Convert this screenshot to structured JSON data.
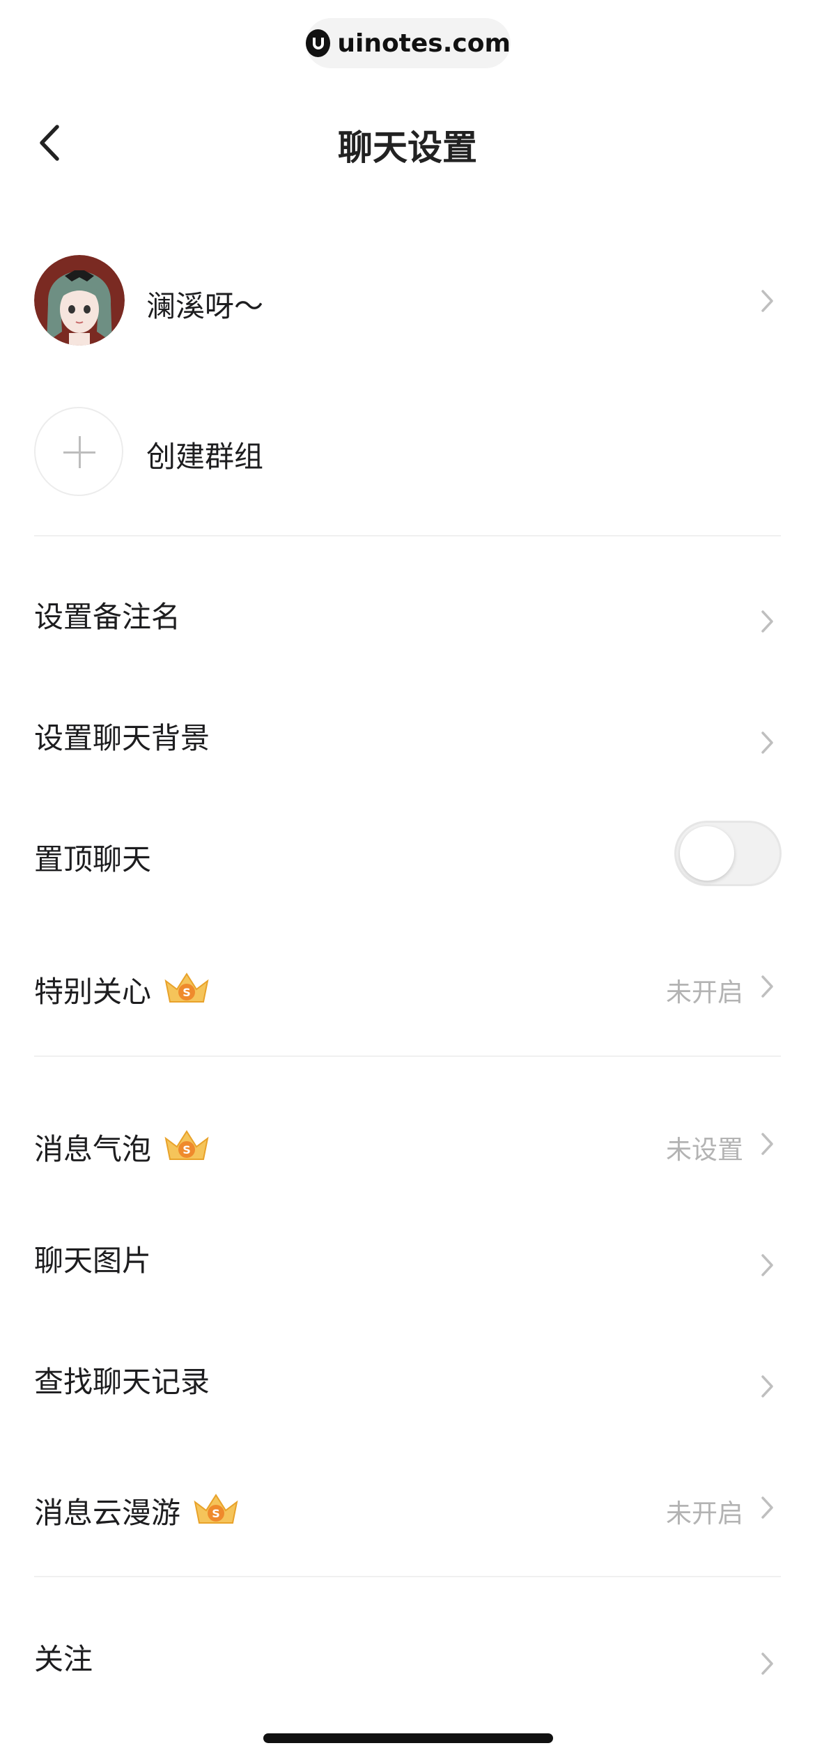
{
  "watermark": {
    "text": "uinotes.com"
  },
  "nav": {
    "title": "聊天设置"
  },
  "profile": {
    "name": "澜溪呀～"
  },
  "create_group": {
    "label": "创建群组"
  },
  "rows": {
    "remark": {
      "label": "设置备注名"
    },
    "background": {
      "label": "设置聊天背景"
    },
    "pin": {
      "label": "置顶聊天",
      "enabled": false
    },
    "special_care": {
      "label": "特别关心",
      "value": "未开启"
    },
    "bubble": {
      "label": "消息气泡",
      "value": "未设置"
    },
    "images": {
      "label": "聊天图片"
    },
    "search_history": {
      "label": "查找聊天记录"
    },
    "cloud_roaming": {
      "label": "消息云漫游",
      "value": "未开启"
    },
    "follow": {
      "label": "关注"
    }
  },
  "colors": {
    "vip_crown": "#f5b13a",
    "chevron": "#bfbfbf",
    "secondary_text": "#b3b3b3"
  },
  "icons": [
    "back-icon",
    "chevron-right-icon",
    "plus-icon",
    "vip-crown-icon"
  ]
}
